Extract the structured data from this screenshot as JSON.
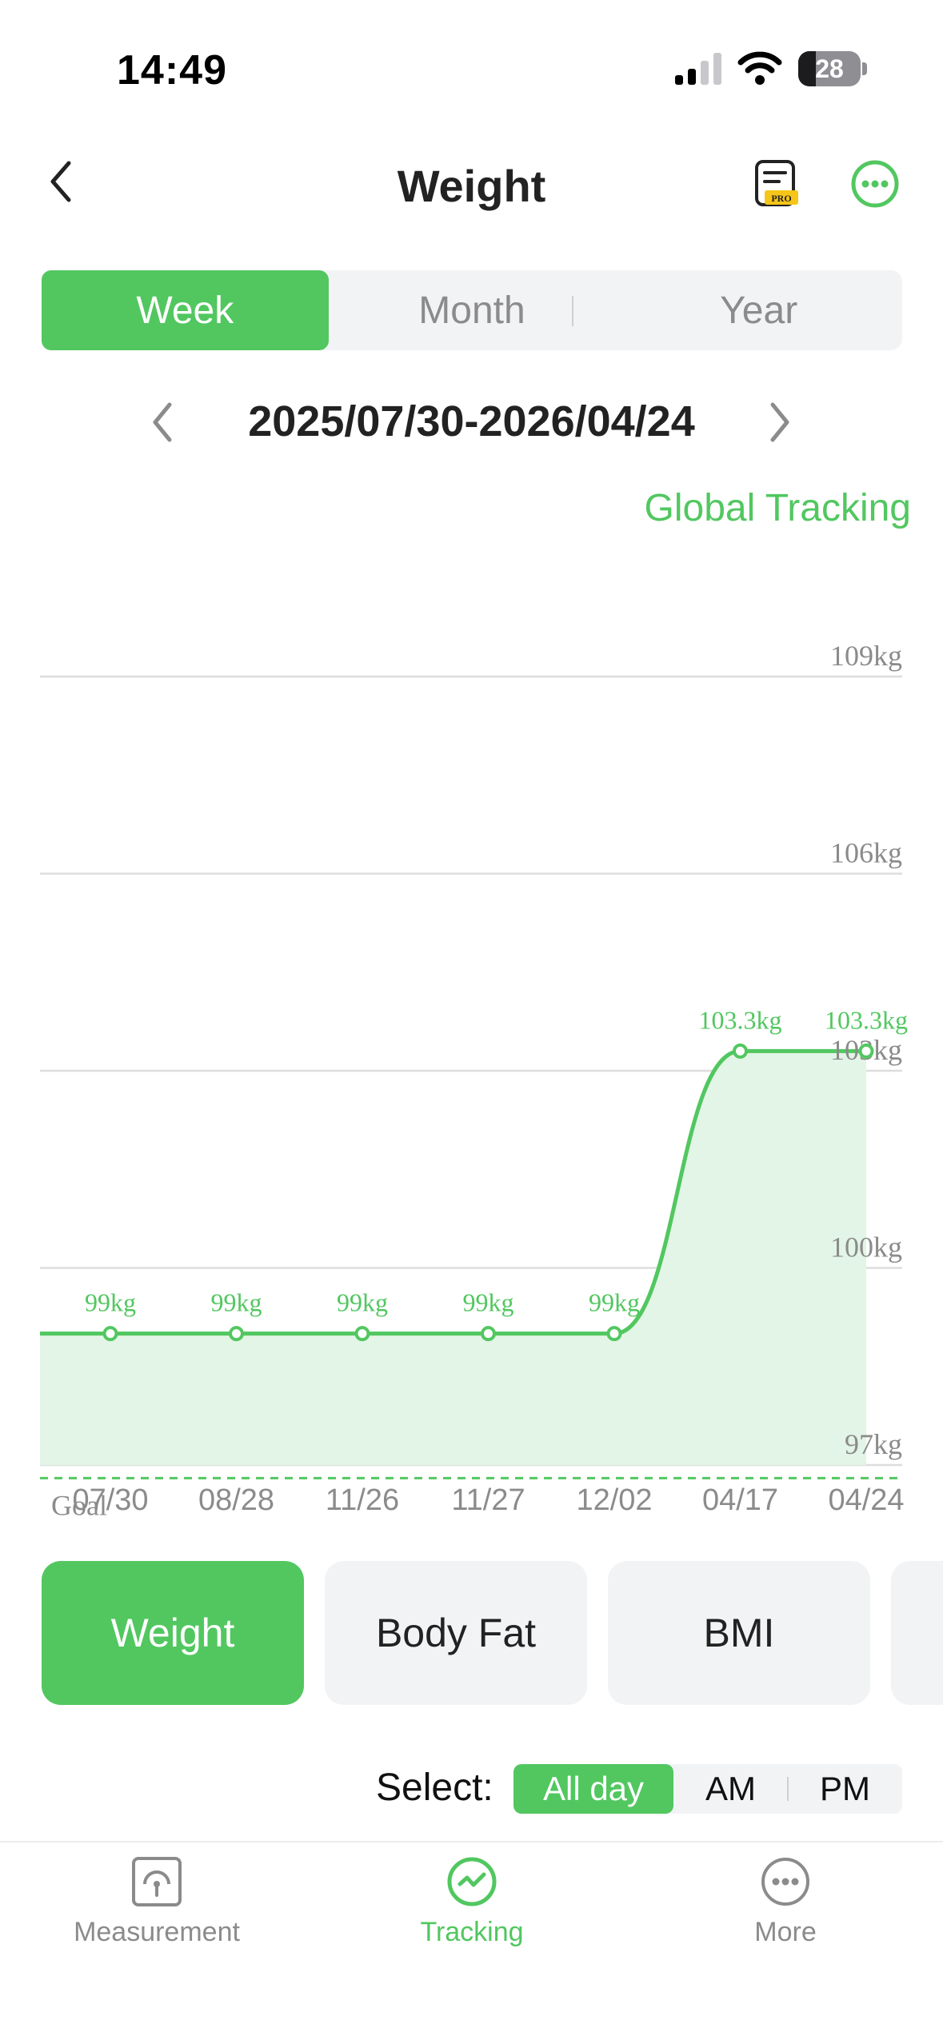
{
  "status": {
    "time": "14:49",
    "battery": "28"
  },
  "header": {
    "title": "Weight"
  },
  "period_tabs": [
    {
      "label": "Week",
      "active": true
    },
    {
      "label": "Month",
      "active": false
    },
    {
      "label": "Year",
      "active": false
    }
  ],
  "date_range": "2025/07/30-2026/04/24",
  "global_tracking": "Global Tracking",
  "colors": {
    "accent": "#52c760",
    "fill": "#e3f5e6",
    "grid": "#dddddd",
    "axis_text": "#8b8b8b"
  },
  "chart_data": {
    "type": "line",
    "categories": [
      "07/30",
      "08/28",
      "11/26",
      "11/27",
      "12/02",
      "04/17",
      "04/24"
    ],
    "values": [
      99,
      99,
      99,
      99,
      99,
      103.3,
      103.3
    ],
    "data_labels": [
      "99kg",
      "99kg",
      "99kg",
      "99kg",
      "99kg",
      "103.3kg",
      "103.3kg"
    ],
    "y_ticks": [
      97,
      100,
      103,
      106,
      109
    ],
    "y_tick_labels": [
      "97kg",
      "100kg",
      "103kg",
      "106kg",
      "109kg"
    ],
    "ylim": [
      97,
      109
    ],
    "goal": {
      "label": "Goal",
      "value": 96.8
    },
    "grid": true
  },
  "metrics": [
    {
      "label": "Weight",
      "active": true
    },
    {
      "label": "Body Fat",
      "active": false
    },
    {
      "label": "BMI",
      "active": false
    }
  ],
  "select": {
    "label": "Select:",
    "options": [
      {
        "label": "All day",
        "active": true
      },
      {
        "label": "AM",
        "active": false
      },
      {
        "label": "PM",
        "active": false
      }
    ]
  },
  "nav": [
    {
      "label": "Measurement",
      "icon": "scale-icon",
      "active": false
    },
    {
      "label": "Tracking",
      "icon": "tracking-icon",
      "active": true
    },
    {
      "label": "More",
      "icon": "more-icon",
      "active": false
    }
  ]
}
